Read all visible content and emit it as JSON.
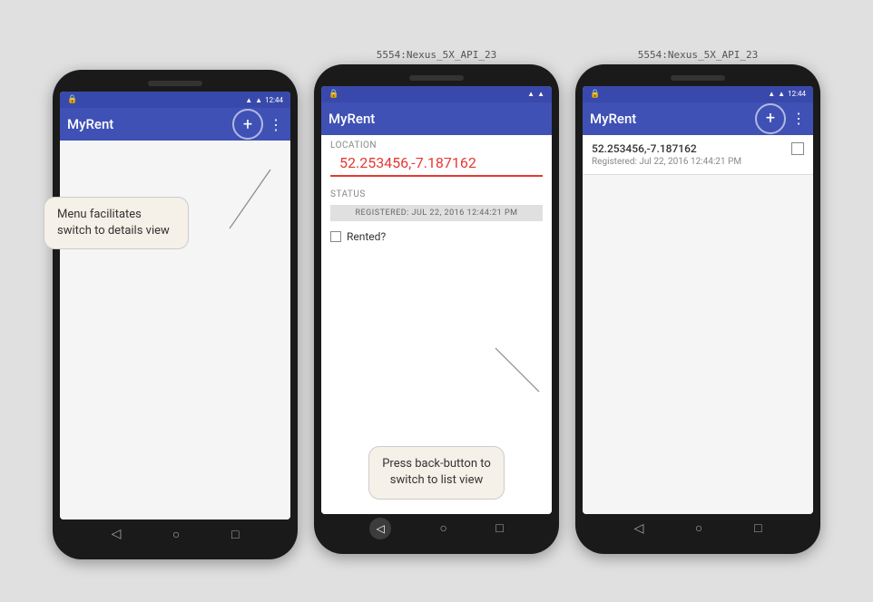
{
  "background": "#e0e0e0",
  "phones": [
    {
      "id": "phone1",
      "label": "",
      "hasLabel": false,
      "appBarTitle": "MyRent",
      "showFab": true,
      "showMenuDots": true,
      "statusBarTime": "12:44",
      "screenType": "list-empty",
      "callout": {
        "text": "Menu facilitates switch to details view",
        "position": "left"
      }
    },
    {
      "id": "phone2",
      "label": "5554:Nexus_5X_API_23",
      "hasLabel": true,
      "appBarTitle": "MyRent",
      "showFab": false,
      "showMenuDots": false,
      "statusBarTime": "",
      "screenType": "details",
      "callout": {
        "text": "Press back-button to switch to list view",
        "position": "bottom"
      },
      "details": {
        "locationLabel": "LOCATION",
        "locationValue": "52.253456,-7.187162",
        "statusLabel": "STATUS",
        "statusChip": "REGISTERED: JUL 22, 2016 12:44:21 PM",
        "rentedLabel": "Rented?"
      }
    },
    {
      "id": "phone3",
      "label": "5554:Nexus_5X_API_23",
      "hasLabel": true,
      "appBarTitle": "MyRent",
      "showFab": true,
      "showMenuDots": true,
      "statusBarTime": "12:44",
      "screenType": "list-with-item",
      "listItem": {
        "title": "52.253456,-7.187162",
        "subtitle": "Registered: Jul 22, 2016 12:44:21 PM"
      }
    }
  ],
  "icons": {
    "back": "◁",
    "home": "○",
    "recents": "□",
    "plus": "+",
    "signal": "▲",
    "wifi": "▲",
    "battery": "▮"
  }
}
